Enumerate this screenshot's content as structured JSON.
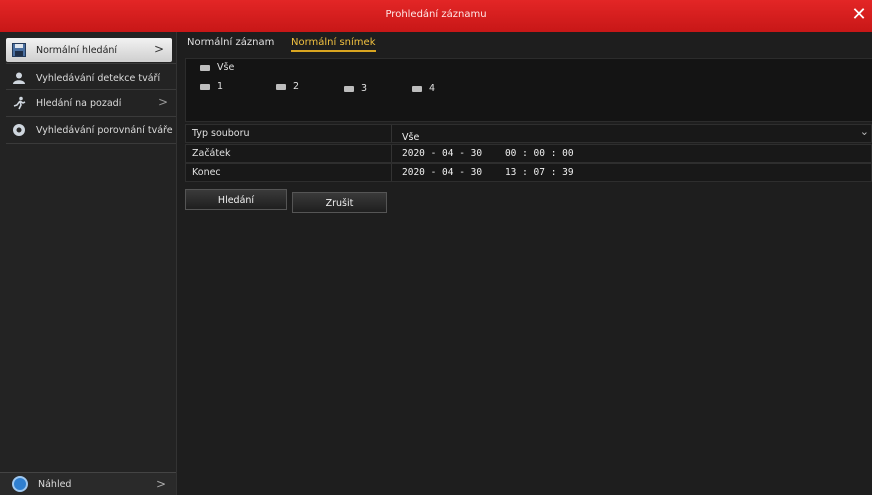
{
  "window": {
    "title": "Prohledání záznamu",
    "close_glyph": "✕"
  },
  "sidebar": {
    "items": [
      {
        "label": "Normální hledání",
        "icon": "floppy-disk-icon"
      },
      {
        "label": "Vyhledávání detekce tváří",
        "icon": "person-icon"
      },
      {
        "label": "Hledání na pozadí",
        "icon": "running-person-icon"
      },
      {
        "label": "Vyhledávání porovnání tváře",
        "icon": "compare-face-icon"
      }
    ],
    "bottom": {
      "label": "Náhled"
    }
  },
  "tabs": [
    {
      "label": "Normální záznam"
    },
    {
      "label": "Normální snímek",
      "active": true
    }
  ],
  "channels": {
    "all_label": "Vše",
    "items": [
      "1",
      "2",
      "3",
      "4"
    ]
  },
  "form": {
    "file_type": {
      "label": "Typ souboru",
      "value": "Vše"
    },
    "start": {
      "label": "Začátek",
      "value": "2020 - 04 - 30    00 : 00 : 00"
    },
    "end": {
      "label": "Konec",
      "value": "2020 - 04 - 30    13 : 07 : 39"
    }
  },
  "buttons": {
    "search": "Hledání",
    "cancel": "Zrušit"
  },
  "colors": {
    "titlebar": "#d81e1e",
    "active_tab": "#f0c040",
    "accent_blue": "#2f7fd0"
  }
}
